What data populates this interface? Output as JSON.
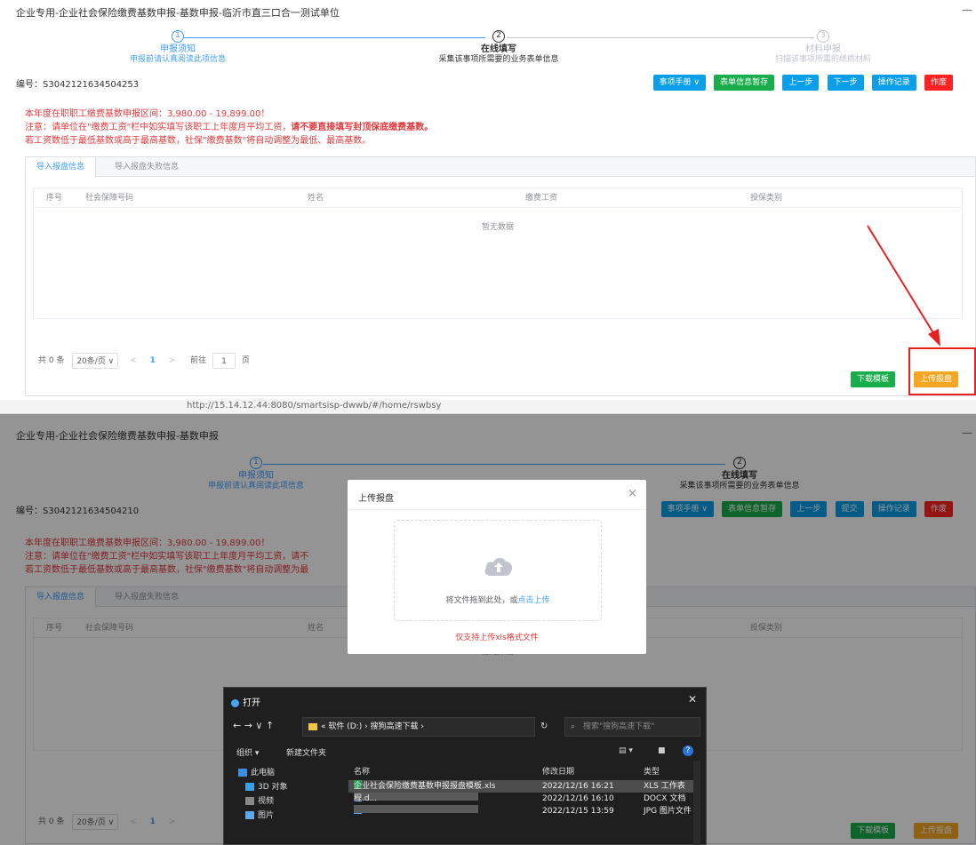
{
  "panel1": {
    "window_title": "企业专用-企业社会保险缴费基数申报-基数申报-临沂市直三口合一测试单位",
    "minimize": "—",
    "steps": [
      {
        "num": "1",
        "title": "申报须知",
        "desc": "申报前请认真阅读此项信息"
      },
      {
        "num": "2",
        "title": "在线填写",
        "desc": "采集该事项所需要的业务表单信息"
      },
      {
        "num": "3",
        "title": "材料申报",
        "desc": "扫描该事项所需的纸质材料"
      }
    ],
    "serial": "编号：S3042121634504253",
    "buttons": [
      "事项手册 ∨",
      "表单信息暂存",
      "上一步",
      "下一步",
      "操作记录",
      "作废"
    ],
    "notice": {
      "line1": "本年度在职职工缴费基数申报区间：3,980.00 - 19,899.00！",
      "line2_normal": "注意：请单位在\"缴费工资\"栏中如实填写该职工上年度月平均工资，",
      "line2_bold": "请不要直接填写封顶保底缴费基数。",
      "line3": "若工资数低于最低基数或高于最高基数，社保\"缴费基数\"将自动调整为最低、最高基数。"
    },
    "tabs": [
      "导入报盘信息",
      "导入报盘失败信息"
    ],
    "columns": [
      "序号",
      "社会保障号码",
      "姓名",
      "缴费工资",
      "投保类别"
    ],
    "empty_text": "暂无数据",
    "pager": {
      "total": "共 0 条",
      "size": "20条/页  ∨",
      "prev": "<",
      "page": "1",
      "next": ">",
      "goto": "前往",
      "input": "1",
      "unit": "页"
    },
    "download_btn": "下载模板",
    "upload_btn": "上传报盘"
  },
  "panel2": {
    "browser_url": "http://15.14.12.44:8080/smartsisp-dwwb/#/home/rswbsy",
    "window_title": "企业专用-企业社会保险缴费基数申报-基数申报",
    "minimize": "—",
    "steps": [
      {
        "num": "1",
        "title": "申报须知",
        "desc": "申报前请认真阅读此项信息"
      },
      {
        "num": "2",
        "title": "在线填写",
        "desc": "采集该事项所需要的业务表单信息"
      }
    ],
    "serial": "编号：S3042121634504210",
    "buttons": [
      "事项手册 ∨",
      "表单信息暂存",
      "上一步",
      "提交",
      "操作记录",
      "作废"
    ],
    "notice": {
      "line1": "本年度在职职工缴费基数申报区间：3,980.00 - 19,899.00！",
      "line2": "注意：请单位在\"缴费工资\"栏中如实填写该职工上年度月平均工资，请不",
      "line3": "若工资数低于最低基数或高于最高基数，社保\"缴费基数\"将自动调整为最"
    },
    "tabs": [
      "导入报盘信息",
      "导入报盘失败信息"
    ],
    "columns": [
      "序号",
      "社会保障号码",
      "姓名",
      "投保类别"
    ],
    "empty_text": "暂无数据",
    "pager": {
      "total": "共 0 条",
      "size": "20条/页  ∨",
      "prev": "<",
      "page": "1",
      "next": ">"
    },
    "download_btn": "下载模板",
    "upload_btn": "上传报盘",
    "modal": {
      "title": "上传报盘",
      "close": "×",
      "drop_text": "将文件拖到此处，或",
      "drop_link": "点击上传",
      "tip": "仅支持上传xls格式文件"
    },
    "file_dialog": {
      "title": "打开",
      "close": "✕",
      "nav_arrows": "←  →  ∨  ↑",
      "path": "« 软件 (D:) › 搜狗高速下载 ›",
      "refresh": "↻",
      "search_placeholder": "搜索\"搜狗高速下载\"",
      "organize": "组织 ▾",
      "new_folder": "新建文件夹",
      "sidebar": [
        "此电脑",
        "3D 对象",
        "视频",
        "图片"
      ],
      "col_name": "名称",
      "col_date": "修改日期",
      "col_type": "类型",
      "files": [
        {
          "name": "企业社会保险缴费基数申报报盘模板.xls",
          "date": "2022/12/16 16:21",
          "type": "XLS 工作表"
        },
        {
          "name": "程.d...",
          "date": "2022/12/16 16:10",
          "type": "DOCX 文档"
        },
        {
          "name": "",
          "date": "2022/12/15 13:59",
          "type": "JPG 图片文件"
        }
      ]
    }
  },
  "colors": {
    "primary": "#409eff",
    "green": "#1aad4b",
    "red": "#ff2222",
    "orange": "#f5a623",
    "warn_text": "#e4393c"
  }
}
